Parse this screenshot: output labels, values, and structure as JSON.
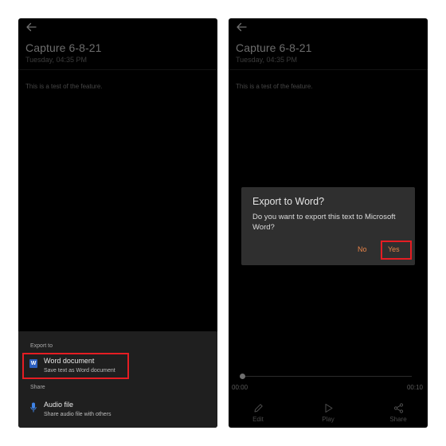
{
  "recording": {
    "title": "Capture 6-8-21",
    "date": "Tuesday, 04:35 PM",
    "transcript": "This is a test of the feature."
  },
  "export_sheet": {
    "export_heading": "Export to",
    "word_item": {
      "title": "Word document",
      "subtitle": "Save text as Word document",
      "icon": "word-icon"
    },
    "share_heading": "Share",
    "audio_item": {
      "title": "Audio file",
      "subtitle": "Share audio file with others",
      "icon": "microphone-icon"
    }
  },
  "dialog": {
    "title": "Export to Word?",
    "body": "Do you want to export this text to Microsoft Word?",
    "no_label": "No",
    "yes_label": "Yes"
  },
  "player": {
    "current_time": "00:00",
    "total_time": "00:10",
    "progress": 0,
    "edit_label": "Edit",
    "play_label": "Play",
    "share_label": "Share"
  },
  "colors": {
    "highlight": "#e51d23",
    "dialog_button": "#e98448",
    "background": "#000000",
    "sheet": "#1f1f1f",
    "word_brand": "#2b5ebd"
  }
}
